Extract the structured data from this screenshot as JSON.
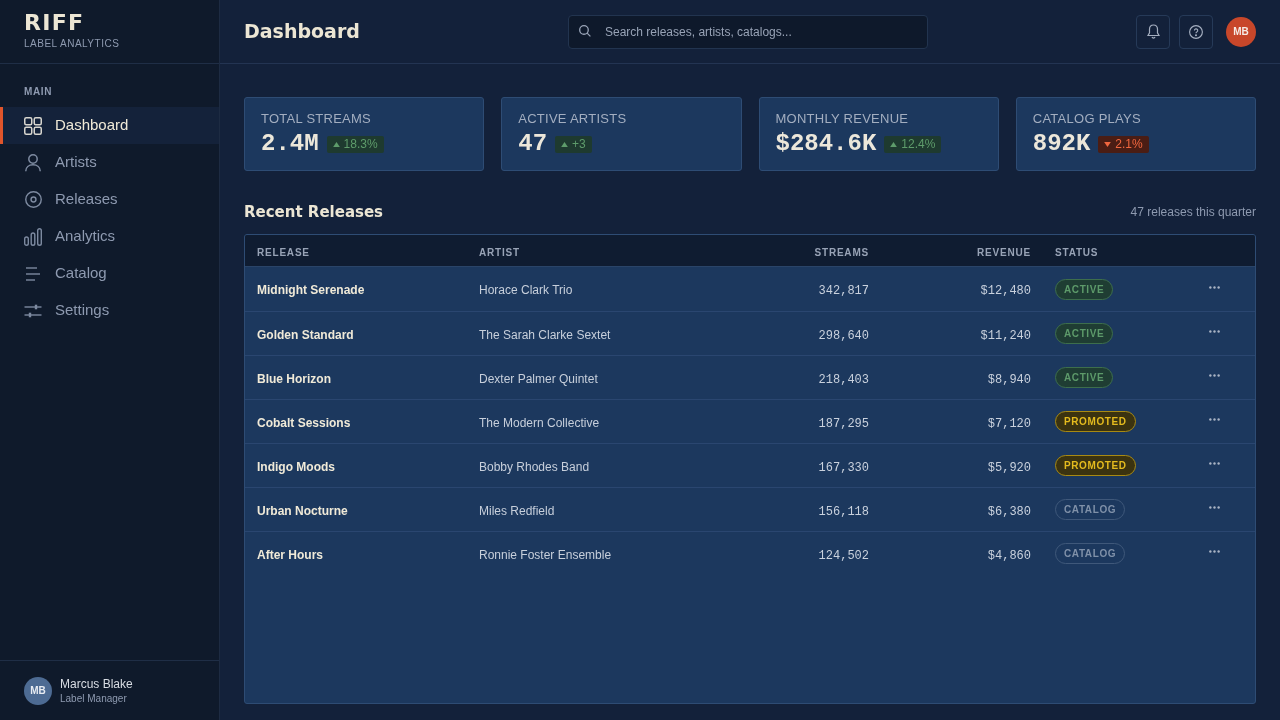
{
  "sidebar": {
    "logo": {
      "title": "RIFF",
      "subtitle": "LABEL ANALYTICS"
    },
    "section_label": "MAIN",
    "items": [
      {
        "label": "Dashboard",
        "selected": true
      },
      {
        "label": "Artists",
        "selected": false
      },
      {
        "label": "Releases",
        "selected": false
      },
      {
        "label": "Analytics",
        "selected": false
      },
      {
        "label": "Catalog",
        "selected": false
      },
      {
        "label": "Settings",
        "selected": false
      }
    ],
    "user": {
      "initials": "MB",
      "name": "Marcus Blake",
      "role": "Label Manager"
    }
  },
  "header": {
    "title": "Dashboard",
    "search": {
      "placeholder": "Search releases, artists, catalogs..."
    },
    "avatar": "MB"
  },
  "stats": [
    {
      "label": "TOTAL STREAMS",
      "value": "2.4M",
      "delta": {
        "text": "18.3%",
        "kind": "up"
      }
    },
    {
      "label": "ACTIVE ARTISTS",
      "value": "47",
      "delta": {
        "text": "+3",
        "kind": "up"
      }
    },
    {
      "label": "MONTHLY REVENUE",
      "value": "$284.6K",
      "delta": {
        "text": "12.4%",
        "kind": "up"
      }
    },
    {
      "label": "CATALOG PLAYS",
      "value": "892K",
      "delta": {
        "text": "2.1%",
        "kind": "down"
      }
    }
  ],
  "releases": {
    "title": "Recent Releases",
    "summary": "47 releases this quarter",
    "columns": [
      "RELEASE",
      "ARTIST",
      "STREAMS",
      "REVENUE",
      "STATUS"
    ],
    "rows": [
      {
        "release": "Midnight Serenade",
        "artist": "Horace Clark Trio",
        "streams": "342,817",
        "revenue": "$12,480",
        "status": {
          "label": "ACTIVE",
          "kind": "active"
        }
      },
      {
        "release": "Golden Standard",
        "artist": "The Sarah Clarke Sextet",
        "streams": "298,640",
        "revenue": "$11,240",
        "status": {
          "label": "ACTIVE",
          "kind": "active"
        }
      },
      {
        "release": "Blue Horizon",
        "artist": "Dexter Palmer Quintet",
        "streams": "218,403",
        "revenue": "$8,940",
        "status": {
          "label": "ACTIVE",
          "kind": "active"
        }
      },
      {
        "release": "Cobalt Sessions",
        "artist": "The Modern Collective",
        "streams": "187,295",
        "revenue": "$7,120",
        "status": {
          "label": "PROMOTED",
          "kind": "promoted"
        }
      },
      {
        "release": "Indigo Moods",
        "artist": "Bobby Rhodes Band",
        "streams": "167,330",
        "revenue": "$5,920",
        "status": {
          "label": "PROMOTED",
          "kind": "promoted"
        }
      },
      {
        "release": "Urban Nocturne",
        "artist": "Miles Redfield",
        "streams": "156,118",
        "revenue": "$6,380",
        "status": {
          "label": "CATALOG",
          "kind": "catalog"
        }
      },
      {
        "release": "After Hours",
        "artist": "Ronnie Foster Ensemble",
        "streams": "124,502",
        "revenue": "$4,860",
        "status": {
          "label": "CATALOG",
          "kind": "catalog"
        }
      }
    ]
  }
}
